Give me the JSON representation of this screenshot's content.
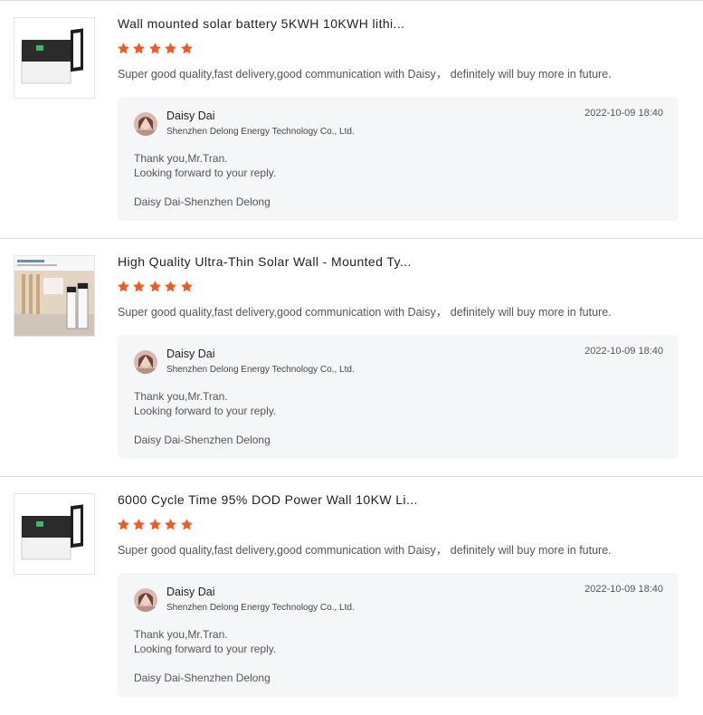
{
  "colors": {
    "star": "#f15a22",
    "reply_bg": "#f5f6f8",
    "divider": "#d9d9d9"
  },
  "icons": {
    "rating": "star-icon"
  },
  "reviews": [
    {
      "product_title": "Wall mounted solar battery 5KWH 10KWH lithi...",
      "rating": 5,
      "comment": "Super good quality,fast delivery,good communication with Daisy， definitely will buy more in future.",
      "reply": {
        "name": "Daisy Dai",
        "company": "Shenzhen Delong Energy Technology Co., Ltd.",
        "date": "2022-10-09 18:40",
        "line1": "Thank you,Mr.Tran.",
        "line2": "Looking forward to your reply.",
        "signature": "Daisy Dai-Shenzhen Delong"
      }
    },
    {
      "product_title": "High Quality Ultra-Thin Solar Wall - Mounted Ty...",
      "rating": 5,
      "comment": "Super good quality,fast delivery,good communication with Daisy， definitely will buy more in future.",
      "reply": {
        "name": "Daisy Dai",
        "company": "Shenzhen Delong Energy Technology Co., Ltd.",
        "date": "2022-10-09 18:40",
        "line1": "Thank you,Mr.Tran.",
        "line2": "Looking forward to your reply.",
        "signature": "Daisy Dai-Shenzhen Delong"
      }
    },
    {
      "product_title": "6000 Cycle Time 95% DOD Power Wall 10KW Li...",
      "rating": 5,
      "comment": "Super good quality,fast delivery,good communication with Daisy， definitely will buy more in future.",
      "reply": {
        "name": "Daisy Dai",
        "company": "Shenzhen Delong Energy Technology Co., Ltd.",
        "date": "2022-10-09 18:40",
        "line1": "Thank you,Mr.Tran.",
        "line2": "Looking forward to your reply.",
        "signature": "Daisy Dai-Shenzhen Delong"
      }
    }
  ]
}
